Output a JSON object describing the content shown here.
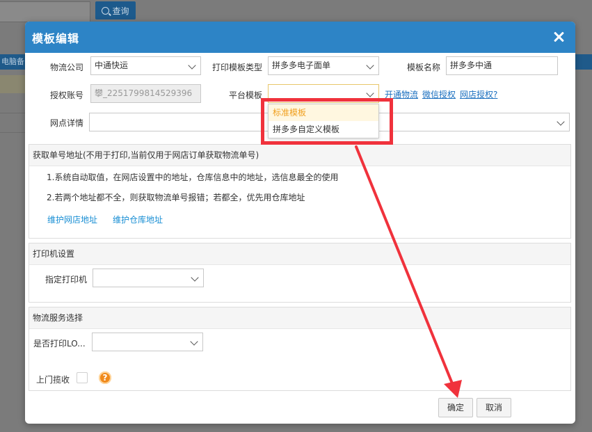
{
  "background": {
    "search_label": "查询",
    "sidebar_text": "电脑备"
  },
  "modal": {
    "title": "模板编辑",
    "fields": {
      "logistics_label": "物流公司",
      "logistics_value": "中通快运",
      "template_type_label": "打印模板类型",
      "template_type_value": "拼多多电子面单",
      "template_name_label": "模板名称",
      "template_name_value": "拼多多中通",
      "auth_account_label": "授权账号",
      "auth_account_value": "攀_2251799814529396",
      "platform_template_label": "平台模板",
      "platform_template_value": "",
      "outlet_label": "网点详情",
      "outlet_value": ""
    },
    "links": {
      "open_logistics": "开通物流",
      "wechat_auth": "微信授权",
      "shop_auth": "网店授权?"
    },
    "dropdown": {
      "options": [
        "标准模板",
        "拼多多自定义模板"
      ],
      "highlighted_index": 0
    },
    "address_panel": {
      "title": "获取单号地址(不用于打印,当前仅用于网店订单获取物流单号)",
      "line1": "1.系统自动取值，在网店设置中的地址，仓库信息中的地址，选信息最全的使用",
      "line2": "2.若两个地址都不全，则获取物流单号报错；若都全，优先用仓库地址",
      "link_shop_address": "维护网店地址",
      "link_warehouse_address": "维护仓库地址"
    },
    "printer_panel": {
      "title": "打印机设置",
      "printer_label": "指定打印机",
      "printer_value": ""
    },
    "service_panel": {
      "title": "物流服务选择",
      "print_logo_label": "是否打印LO...",
      "print_logo_value": "",
      "pickup_label": "上门揽收",
      "pickup_checked": false,
      "help_glyph": "?"
    },
    "buttons": {
      "confirm": "确定",
      "cancel": "取消"
    }
  },
  "annotation": {
    "color": "#f0323c"
  }
}
